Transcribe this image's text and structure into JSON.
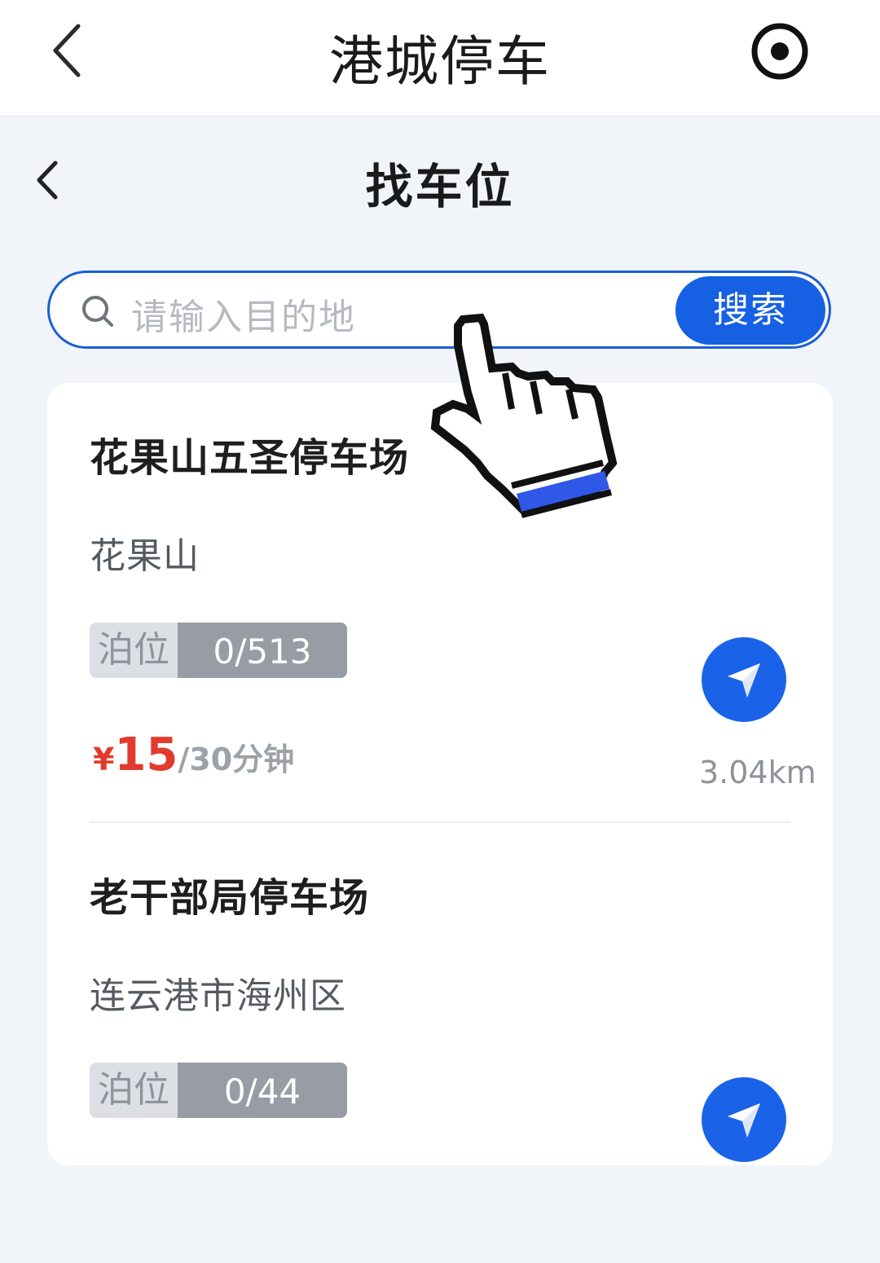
{
  "app": {
    "title": "港城停车"
  },
  "page": {
    "title": "找车位"
  },
  "search": {
    "placeholder": "请输入目的地",
    "button_label": "搜索"
  },
  "lots": [
    {
      "name": "花果山五圣停车场",
      "area": "花果山",
      "spaces_label": "泊位",
      "spaces_value": "0/513",
      "price_currency": "¥",
      "price_amount": "15",
      "price_unit": "/30分钟",
      "distance": "3.04km"
    },
    {
      "name": "老干部局停车场",
      "area": "连云港市海州区",
      "spaces_label": "泊位",
      "spaces_value": "0/44"
    }
  ],
  "colors": {
    "accent": "#1660e3",
    "price": "#e23b2e",
    "badge_value_bg": "#989ca5"
  },
  "icons": {
    "back": "chevron-left-icon",
    "target": "target-icon",
    "search": "search-icon",
    "navigate": "navigation-arrow-icon",
    "cursor": "hand-pointer-cursor-icon"
  }
}
